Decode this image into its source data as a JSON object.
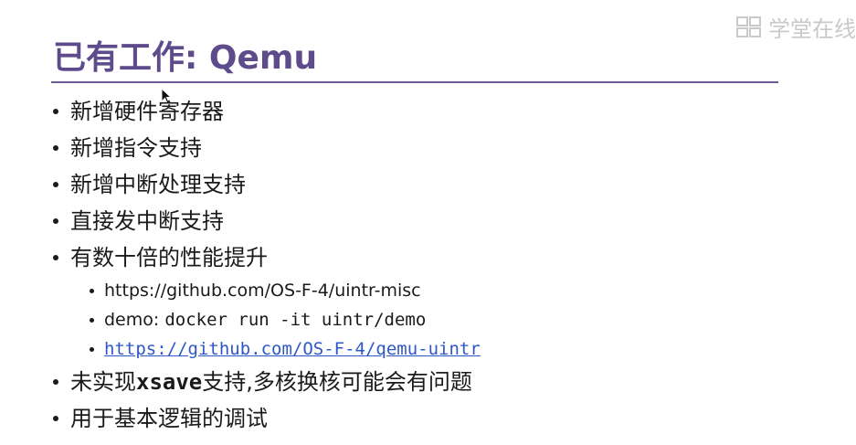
{
  "watermark": {
    "text": "学堂在线"
  },
  "slide": {
    "title": "已有工作: Qemu",
    "bullets": [
      {
        "text": "新增硬件寄存器"
      },
      {
        "text": "新增指令支持"
      },
      {
        "text": "新增中断处理支持"
      },
      {
        "text": "直接发中断支持"
      },
      {
        "text": "有数十倍的性能提升"
      }
    ],
    "sub_bullets": [
      {
        "text": "https://github.com/OS-F-4/uintr-misc"
      },
      {
        "prefix": "demo: ",
        "code": "docker run -it uintr/demo"
      },
      {
        "link": "https://github.com/OS-F-4/qemu-uintr"
      }
    ],
    "bullet_after_1": {
      "part1": "未实现",
      "code": "xsave",
      "part2": "支持,多核换核可能会有问题"
    },
    "bullet_after_2": {
      "text": "用于基本逻辑的调试"
    }
  }
}
